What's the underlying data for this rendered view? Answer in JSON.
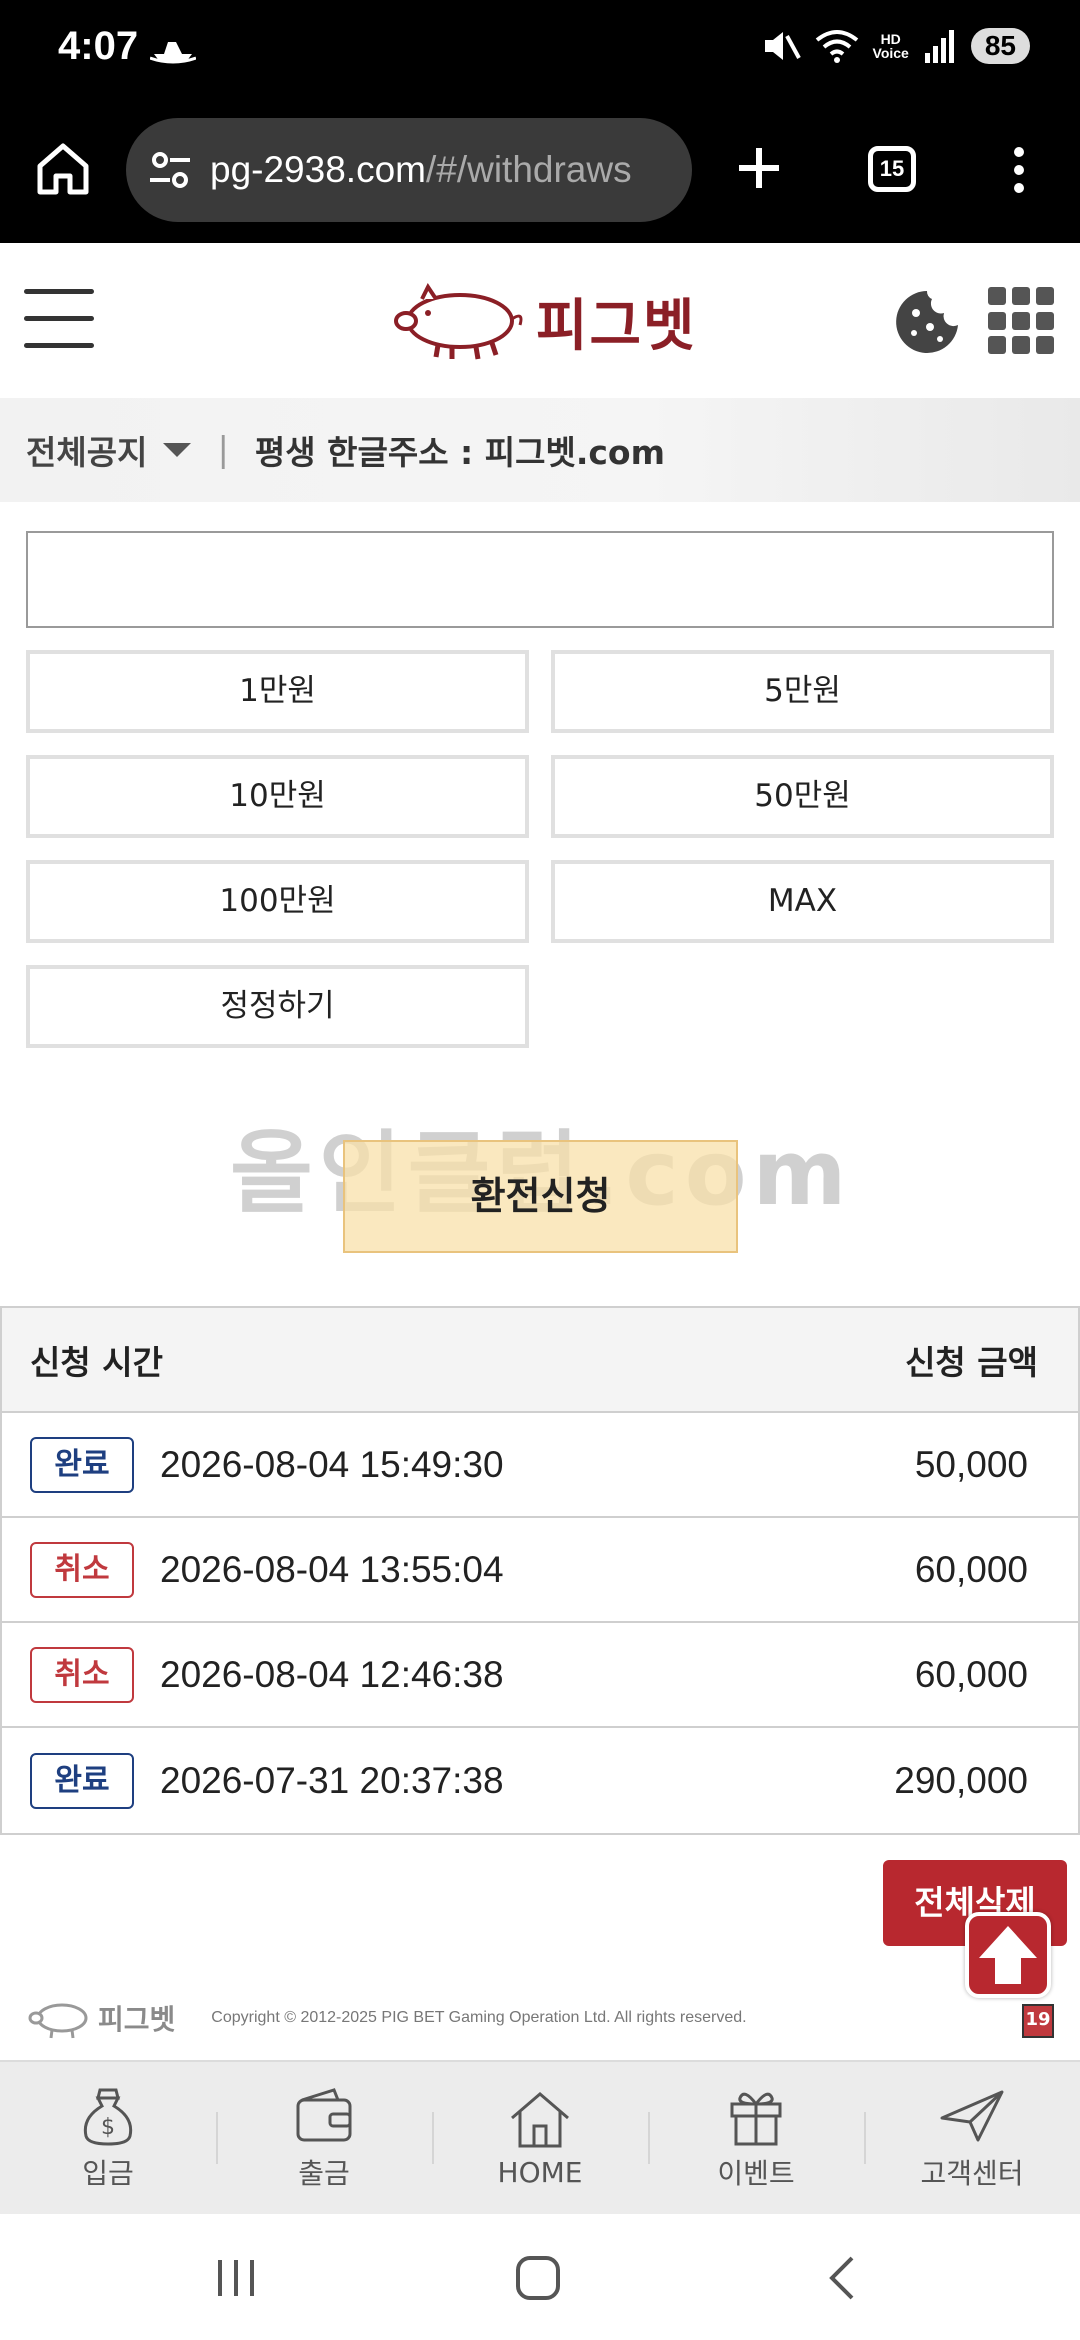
{
  "status_bar": {
    "time": "4:07",
    "battery": "85",
    "hd_label": "HD",
    "voice_label": "Voice"
  },
  "browser": {
    "url_host": "pg-2938.com",
    "url_path": "/#/withdraws",
    "tab_count": "15"
  },
  "header": {
    "logo_text": "피그벳"
  },
  "notice": {
    "category": "전체공지",
    "message": "평생 한글주소 : 피그벳.com"
  },
  "form": {
    "amount_placeholder": "",
    "presets": [
      "1만원",
      "5만원",
      "10만원",
      "50만원",
      "100만원",
      "MAX"
    ],
    "reset_label": "정정하기",
    "submit_label": "환전신청",
    "watermark": "올인클럽.com"
  },
  "table": {
    "col_time": "신청 시간",
    "col_amount": "신청 금액",
    "rows": [
      {
        "status": "완료",
        "datetime": "2026-08-04 15:49:30",
        "amount": "50,000"
      },
      {
        "status": "취소",
        "datetime": "2026-08-04 13:55:04",
        "amount": "60,000"
      },
      {
        "status": "취소",
        "datetime": "2026-08-04 12:46:38",
        "amount": "60,000"
      },
      {
        "status": "완료",
        "datetime": "2026-07-31 20:37:38",
        "amount": "290,000"
      }
    ]
  },
  "delete_all_label": "전체삭제",
  "footer": {
    "logo_text": "피그벳",
    "copyright": "Copyright © 2012-2025 PIG BET Gaming Operation Ltd. All rights reserved.",
    "age_badge": "19"
  },
  "bottom_nav": [
    {
      "icon": "money-bag-icon",
      "label": "입금"
    },
    {
      "icon": "wallet-icon",
      "label": "출금"
    },
    {
      "icon": "house-icon",
      "label": "HOME"
    },
    {
      "icon": "gift-icon",
      "label": "이벤트"
    },
    {
      "icon": "paper-plane-icon",
      "label": "고객센터"
    }
  ],
  "colors": {
    "brand": "#b8282f",
    "done": "#1e3f80",
    "cancel": "#c0393e",
    "submit_bg": "#f8e0aa"
  }
}
